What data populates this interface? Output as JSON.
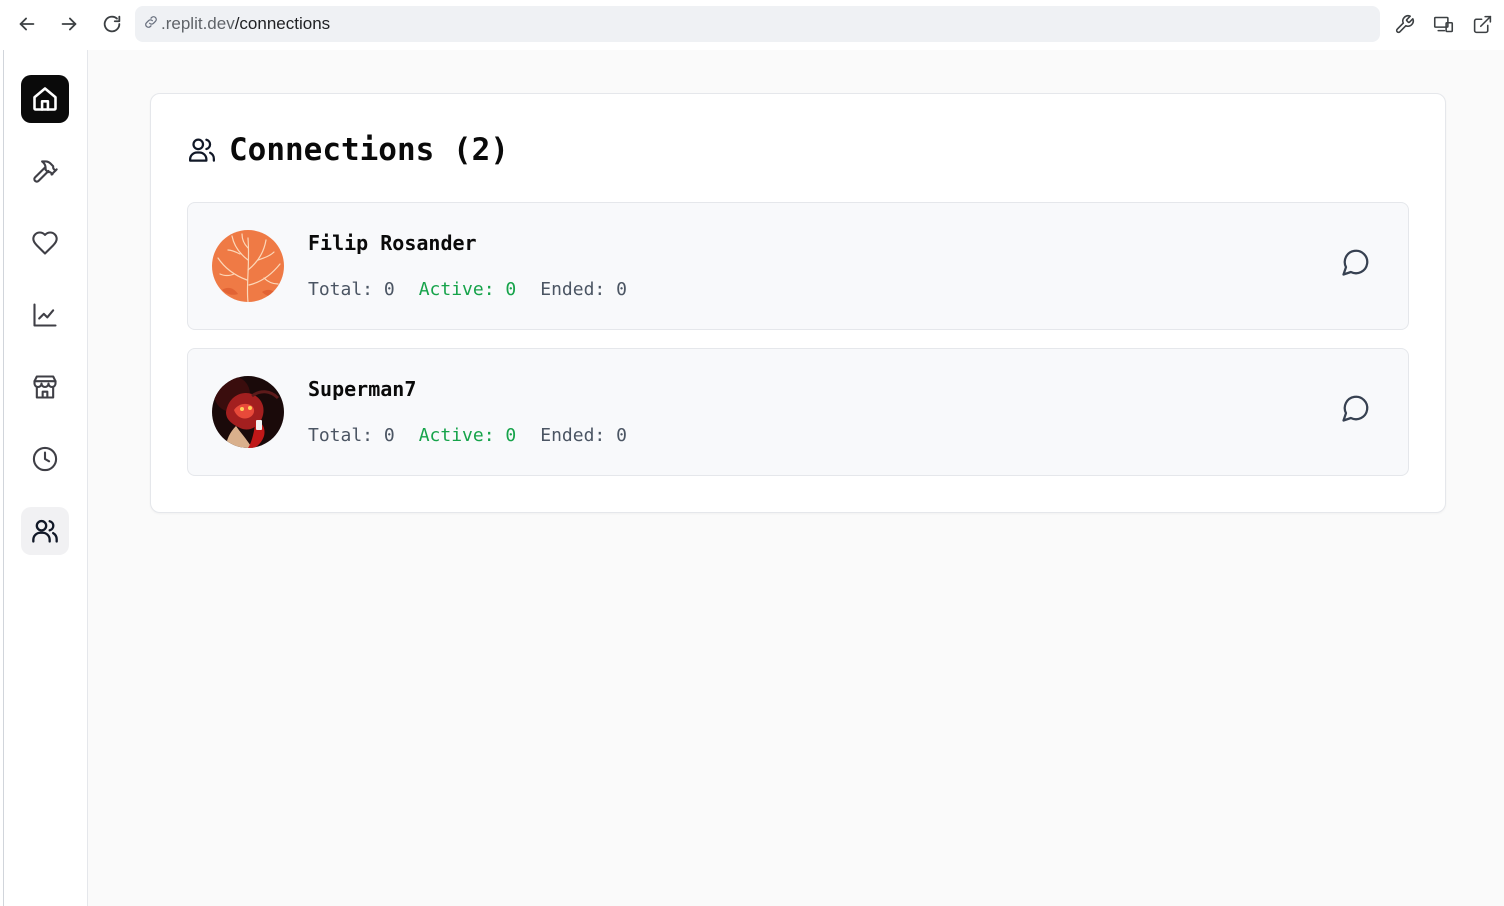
{
  "browser": {
    "url_prefix": ".replit.dev",
    "url_path": "/connections",
    "back_icon": "arrow-left-icon",
    "forward_icon": "arrow-right-icon",
    "reload_icon": "reload-icon",
    "tools": [
      "wrench-icon",
      "devices-icon",
      "external-link-icon"
    ]
  },
  "sidebar": {
    "items": [
      {
        "name": "home",
        "icon": "home-icon",
        "state": "primary"
      },
      {
        "name": "tools",
        "icon": "hammer-icon",
        "state": "default"
      },
      {
        "name": "favorites",
        "icon": "heart-icon",
        "state": "default"
      },
      {
        "name": "analytics",
        "icon": "chart-line-icon",
        "state": "default"
      },
      {
        "name": "store",
        "icon": "store-icon",
        "state": "default"
      },
      {
        "name": "history",
        "icon": "clock-icon",
        "state": "default"
      },
      {
        "name": "connections",
        "icon": "users-icon",
        "state": "active"
      }
    ]
  },
  "main": {
    "title": "Connections (2)",
    "title_icon": "users-icon",
    "connections": [
      {
        "name": "Filip Rosander",
        "avatar": "leaf-pattern-orange-avatar",
        "total_label": "Total: 0",
        "active_label": "Active: 0",
        "ended_label": "Ended: 0",
        "action_icon": "chat-bubble-icon"
      },
      {
        "name": "Superman7",
        "avatar": "red-portrait-avatar",
        "total_label": "Total: 0",
        "active_label": "Active: 0",
        "ended_label": "Ended: 0",
        "action_icon": "chat-bubble-icon"
      }
    ]
  },
  "colors": {
    "active_green": "#16a34a",
    "home_button_bg": "#0a0a0a",
    "page_bg": "#fafafa"
  }
}
